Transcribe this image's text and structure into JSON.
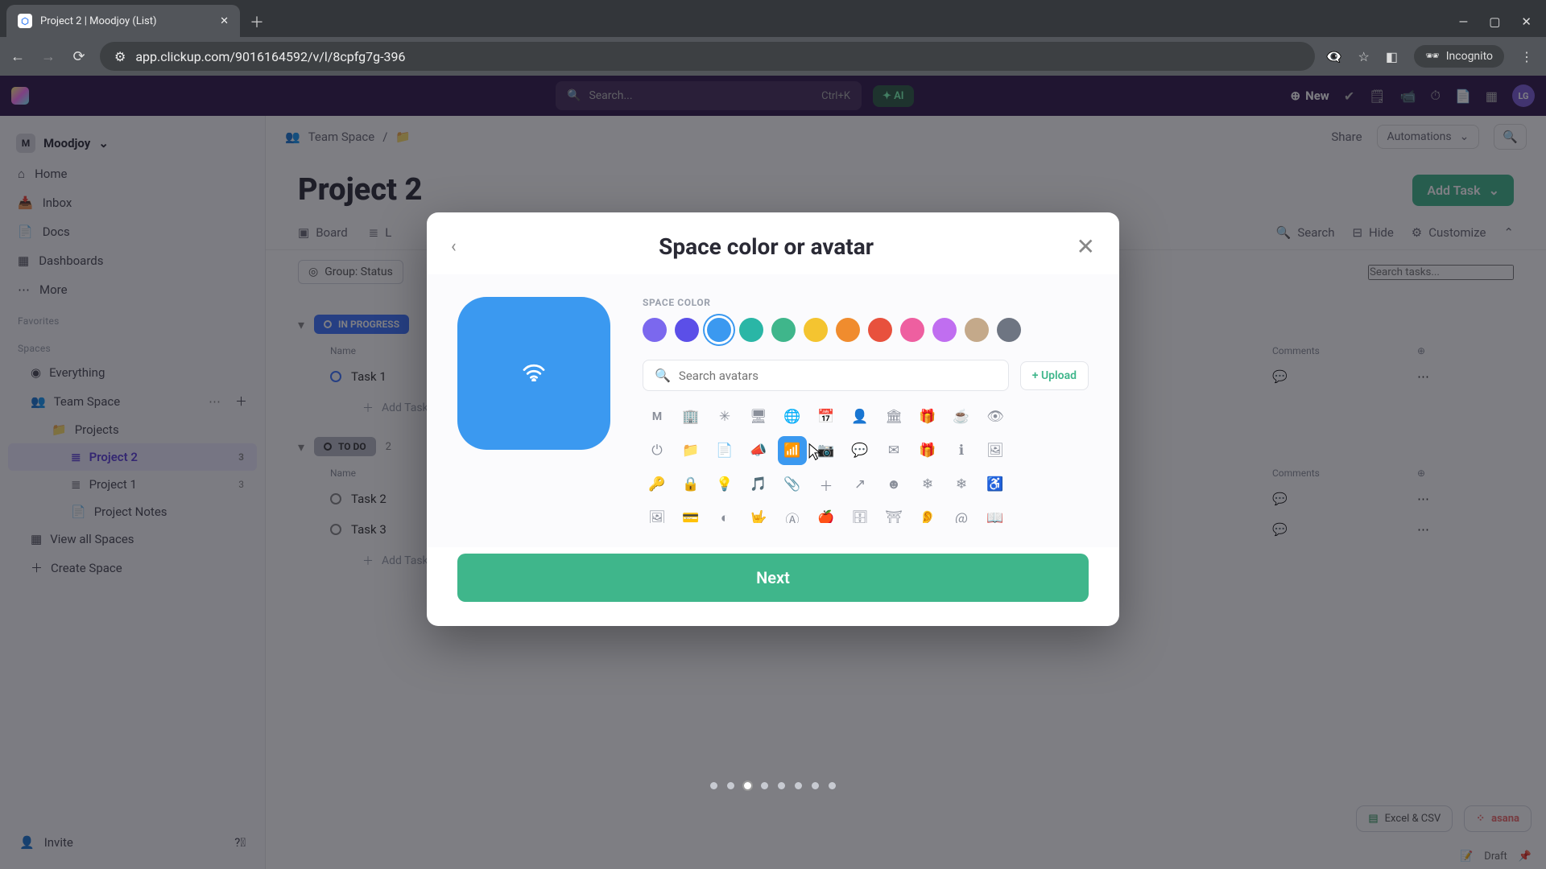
{
  "browser": {
    "tab_title": "Project 2 | Moodjoy (List)",
    "url": "app.clickup.com/9016164592/v/l/8cpfg7g-396",
    "incognito_label": "Incognito"
  },
  "topbar": {
    "search_placeholder": "Search...",
    "search_kbd": "Ctrl+K",
    "ai_label": "AI",
    "new_label": "New",
    "avatar_initials": "LG"
  },
  "sidebar": {
    "workspace": "Moodjoy",
    "workspace_letter": "M",
    "nav": {
      "home": "Home",
      "inbox": "Inbox",
      "docs": "Docs",
      "dashboards": "Dashboards",
      "more": "More"
    },
    "favorites_label": "Favorites",
    "spaces_label": "Spaces",
    "tree": {
      "everything": "Everything",
      "team_space": "Team Space",
      "projects": "Projects",
      "project2": {
        "label": "Project 2",
        "count": "3"
      },
      "project1": {
        "label": "Project 1",
        "count": "3"
      },
      "project_notes": "Project Notes",
      "view_all": "View all Spaces",
      "create": "Create Space"
    },
    "invite": "Invite"
  },
  "breadcrumb": {
    "team_space": "Team Space",
    "share": "Share",
    "automations": "Automations"
  },
  "main": {
    "title": "Project 2",
    "add_task": "Add Task",
    "tabs": {
      "board": "Board",
      "list": "L"
    },
    "tools": {
      "search": "Search",
      "hide": "Hide",
      "customize": "Customize"
    },
    "filter_chip": "Group: Status",
    "search_tasks_placeholder": "Search tasks...",
    "groups": {
      "in_progress": {
        "label": "IN PROGRESS"
      },
      "todo": {
        "label": "TO DO",
        "count": "2"
      }
    },
    "cols": {
      "name": "Name",
      "comments": "Comments"
    },
    "tasks": {
      "t1": "Task 1",
      "t2": "Task 2",
      "t3": "Task 3",
      "add": "Add Task"
    },
    "excel_pill": "Excel & CSV",
    "asana_pill": "asana",
    "draft": "Draft"
  },
  "modal": {
    "title": "Space color or avatar",
    "section_label": "SPACE COLOR",
    "search_placeholder": "Search avatars",
    "upload_label": "+ Upload",
    "next_label": "Next",
    "colors": [
      "#7b68ee",
      "#5b4fe8",
      "#3b99f0",
      "#2ab6a6",
      "#3fb68b",
      "#f4c430",
      "#f08c2e",
      "#e8513d",
      "#ee5fa0",
      "#c06ef0",
      "#c4a98a",
      "#6e7582"
    ],
    "selected_color_index": 2,
    "avatar_letter": "M",
    "avatar_glyphs": [
      "🏢",
      "✳",
      "🖥",
      "🌐",
      "📅",
      "👤",
      "🏛",
      "🎁",
      "☕",
      "👁",
      "⏻",
      "📁",
      "📄",
      "📣",
      "📶",
      "📷",
      "💬",
      "✉",
      "🎁",
      "ℹ",
      "🖼",
      "🔑",
      "🔒",
      "💡",
      "🎵",
      "📎",
      "＋",
      "↗",
      "☻",
      "❄",
      "❄",
      "♿",
      "🖼",
      "💳",
      "◐",
      "🤟",
      "Ⓐ",
      "🍎",
      "🗄",
      "⛩",
      "👂",
      "＠",
      "📖"
    ],
    "selected_avatar_index": 15,
    "step_count": 8,
    "active_step": 2
  }
}
